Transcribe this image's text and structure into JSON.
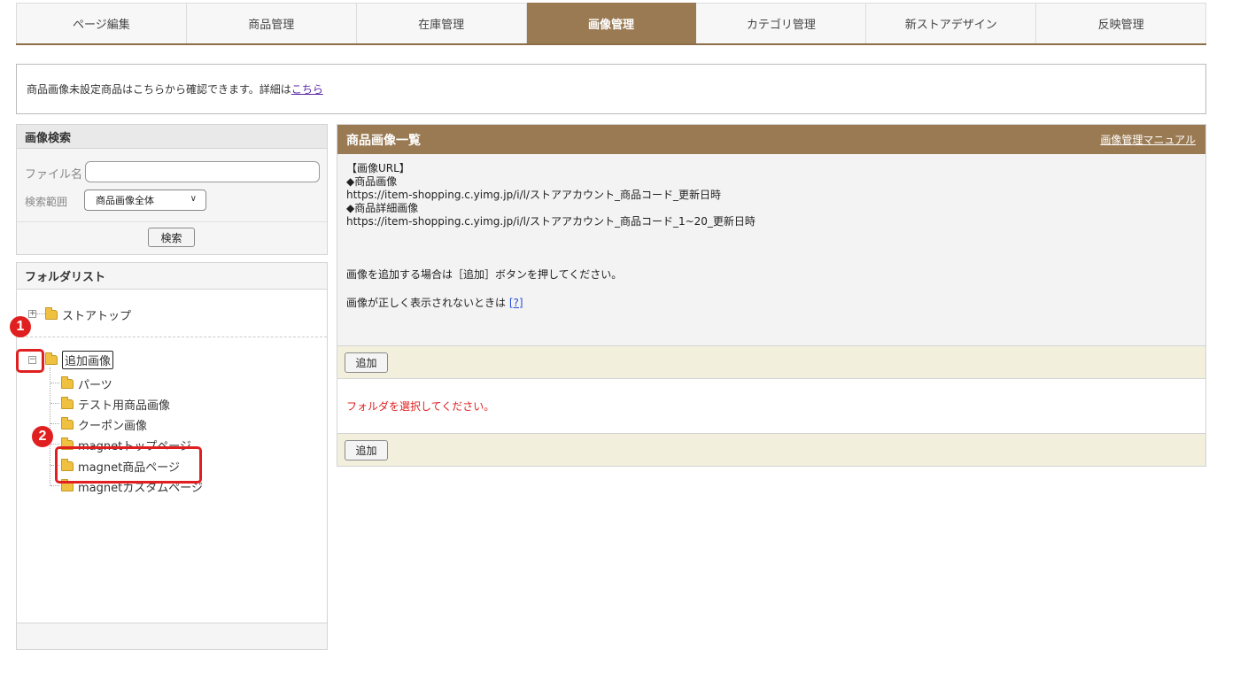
{
  "tabs": [
    {
      "label": "ページ編集"
    },
    {
      "label": "商品管理"
    },
    {
      "label": "在庫管理"
    },
    {
      "label": "画像管理",
      "active": true
    },
    {
      "label": "カテゴリ管理"
    },
    {
      "label": "新ストアデザイン"
    },
    {
      "label": "反映管理"
    }
  ],
  "notice": {
    "text": "商品画像未設定商品はこちらから確認できます。詳細は",
    "link": "こちら"
  },
  "search": {
    "title": "画像検索",
    "filename_label": "ファイル名",
    "filename_value": "",
    "scope_label": "検索範囲",
    "scope_value": "商品画像全体",
    "search_button": "検索"
  },
  "folders": {
    "title": "フォルダリスト",
    "root": "ストアトップ",
    "parent": "追加画像",
    "children": [
      "パーツ",
      "テスト用商品画像",
      "クーポン画像",
      "magnetトップページ",
      "magnet商品ページ",
      "magnetカスタムページ"
    ]
  },
  "annotations": {
    "marker1": "1",
    "marker2": "2",
    "color": "#e02020"
  },
  "main": {
    "title": "商品画像一覧",
    "manual_link": "画像管理マニュアル",
    "url_heading": "【画像URL】",
    "product_image_label": "◆商品画像",
    "product_image_url": "https://item-shopping.c.yimg.jp/i/l/ストアアカウント_商品コード_更新日時",
    "detail_image_label": "◆商品詳細画像",
    "detail_image_url": "https://item-shopping.c.yimg.jp/i/l/ストアアカウント_商品コード_1~20_更新日時",
    "add_instruction": "画像を追加する場合は［追加］ボタンを押してください。",
    "display_help": "画像が正しく表示されないときは",
    "help_link": "[?]",
    "add_button": "追加",
    "select_folder_msg": "フォルダを選択してください。"
  },
  "colors": {
    "accent": "#9a7a53",
    "alert": "#e02020",
    "bar": "#f2f0dc"
  }
}
